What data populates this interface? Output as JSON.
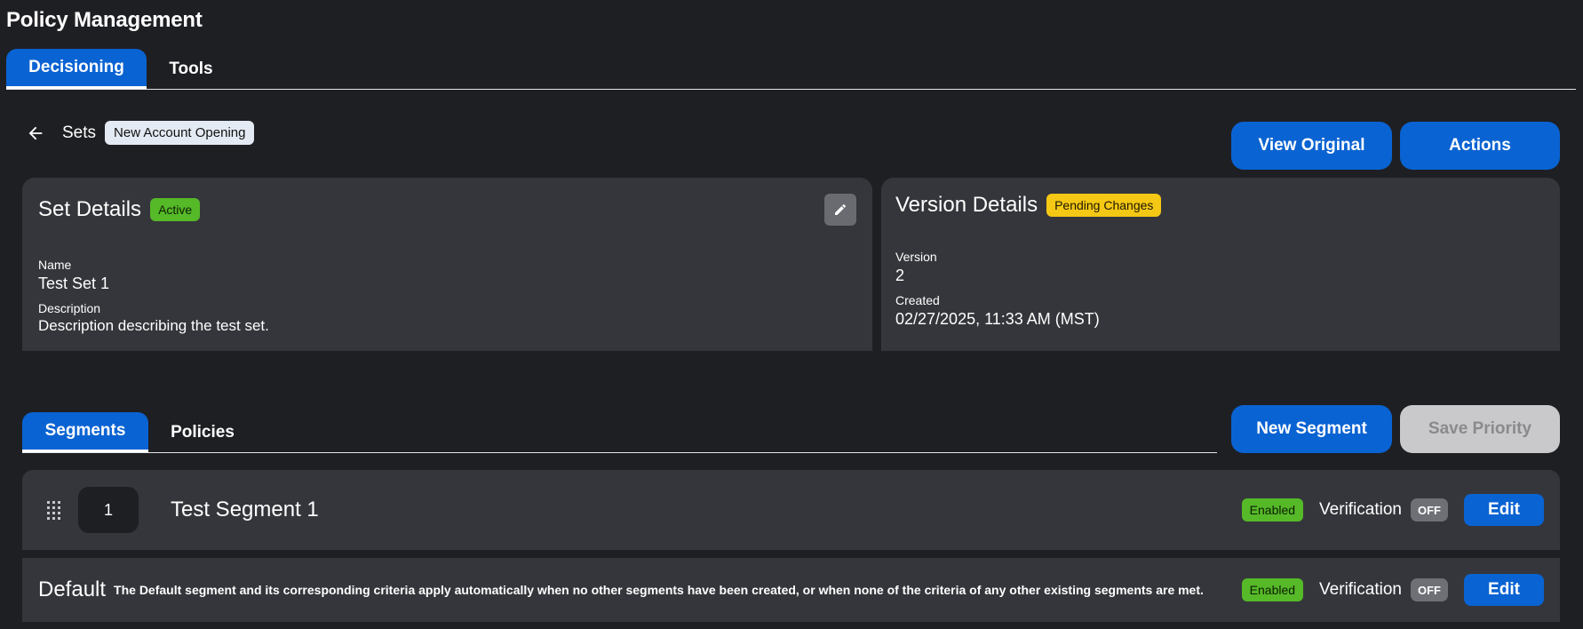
{
  "app": {
    "title": "Policy Management"
  },
  "top_tabs": [
    {
      "label": "Decisioning",
      "active": true
    },
    {
      "label": "Tools",
      "active": false
    }
  ],
  "breadcrumb": {
    "parent": "Sets",
    "current": "New Account Opening"
  },
  "header_buttons": {
    "view_original": "View Original",
    "actions": "Actions"
  },
  "set_details": {
    "title": "Set Details",
    "status": "Active",
    "name_label": "Name",
    "name_value": "Test Set 1",
    "description_label": "Description",
    "description_value": "Description describing the test set."
  },
  "version_details": {
    "title": "Version Details",
    "status": "Pending Changes",
    "version_label": "Version",
    "version_value": "2",
    "created_label": "Created",
    "created_value": "02/27/2025, 11:33 AM (MST)"
  },
  "sub_tabs": [
    {
      "label": "Segments",
      "active": true
    },
    {
      "label": "Policies",
      "active": false
    }
  ],
  "segment_buttons": {
    "new_segment": "New Segment",
    "save_priority": "Save Priority"
  },
  "segments": [
    {
      "priority": "1",
      "name": "Test Segment 1",
      "status": "Enabled",
      "verification_label": "Verification",
      "verification": "OFF",
      "edit": "Edit"
    }
  ],
  "default_segment": {
    "title": "Default",
    "description": "The Default segment and its corresponding criteria apply automatically when no other segments have been created, or when none of the criteria of any other existing segments are met.",
    "status": "Enabled",
    "verification_label": "Verification",
    "verification": "OFF",
    "edit": "Edit"
  },
  "colors": {
    "background": "#1e1f23",
    "card": "#35363b",
    "primary": "#0a63d2",
    "active_badge": "#55b928",
    "pending_badge": "#f4c814",
    "disabled_button": "#c9c9cb"
  },
  "icons": {
    "back": "arrow-left-icon",
    "edit": "pencil-icon",
    "drag": "drag-handle-icon"
  }
}
